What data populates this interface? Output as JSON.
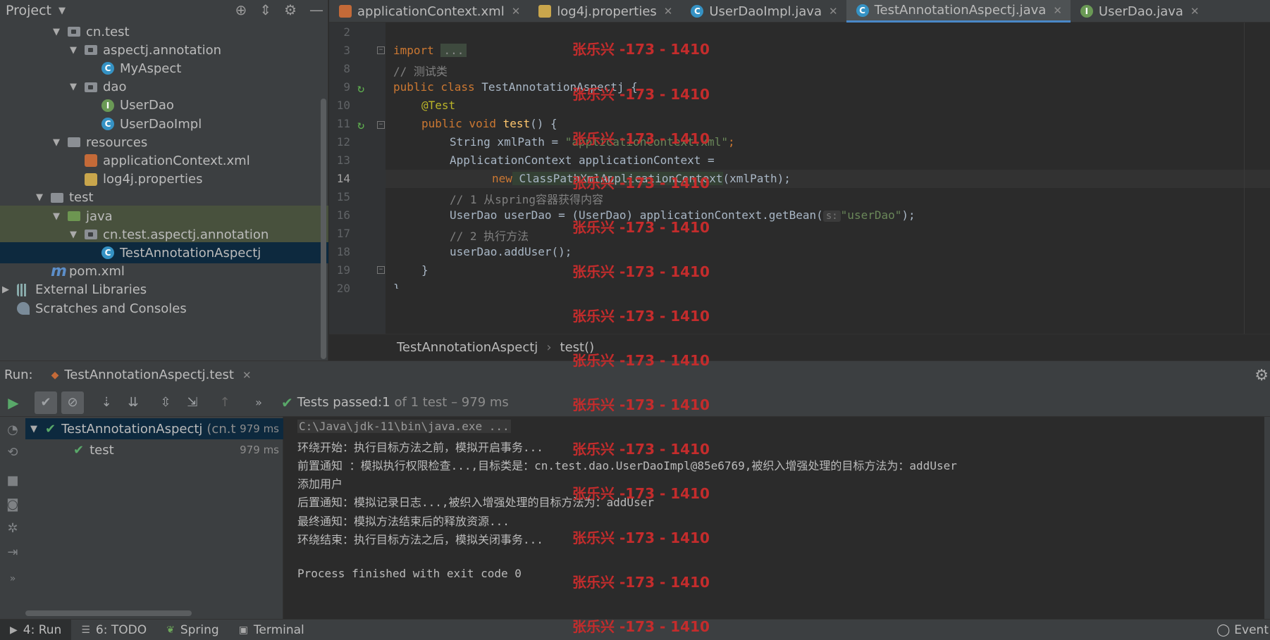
{
  "project": {
    "title": "Project",
    "tree": [
      {
        "label": "cn.test",
        "icon": "package-icon",
        "indent": 1,
        "arrow": "▼"
      },
      {
        "label": "aspectj.annotation",
        "icon": "package-icon",
        "indent": 2,
        "arrow": "▼"
      },
      {
        "label": "MyAspect",
        "icon": "class-icon",
        "indent": 3,
        "arrow": ""
      },
      {
        "label": "dao",
        "icon": "package-icon",
        "indent": 2,
        "arrow": "▼"
      },
      {
        "label": "UserDao",
        "icon": "interface-icon",
        "indent": 3,
        "arrow": ""
      },
      {
        "label": "UserDaoImpl",
        "icon": "class-icon",
        "indent": 3,
        "arrow": ""
      },
      {
        "label": "resources",
        "icon": "folder-icon",
        "indent": 1,
        "arrow": "▼"
      },
      {
        "label": "applicationContext.xml",
        "icon": "xml-file-icon",
        "indent": 2,
        "arrow": ""
      },
      {
        "label": "log4j.properties",
        "icon": "properties-file-icon",
        "indent": 2,
        "arrow": ""
      },
      {
        "label": "test",
        "icon": "folder-icon",
        "indent": 0,
        "arrow": "▼"
      },
      {
        "label": "java",
        "icon": "folder-icon",
        "indent": 1,
        "arrow": "▼"
      },
      {
        "label": "cn.test.aspectj.annotation",
        "icon": "package-icon",
        "indent": 2,
        "arrow": "▼"
      },
      {
        "label": "TestAnnotationAspectj",
        "icon": "class-icon",
        "indent": 3,
        "arrow": ""
      },
      {
        "label": "pom.xml",
        "icon": "maven-icon",
        "indent": 0,
        "arrow": ""
      },
      {
        "label": "External Libraries",
        "icon": "library-icon",
        "indent": -1,
        "arrow": "▶"
      },
      {
        "label": "Scratches and Consoles",
        "icon": "scratch-icon",
        "indent": -1,
        "arrow": ""
      }
    ]
  },
  "tabs": [
    {
      "label": "applicationContext.xml",
      "icon": "xml-file-icon",
      "active": false
    },
    {
      "label": "log4j.properties",
      "icon": "properties-file-icon",
      "active": false
    },
    {
      "label": "UserDaoImpl.java",
      "icon": "class-icon",
      "active": false
    },
    {
      "label": "TestAnnotationAspectj.java",
      "icon": "class-icon",
      "active": true
    },
    {
      "label": "UserDao.java",
      "icon": "interface-icon",
      "active": false
    }
  ],
  "editor": {
    "lines": [
      {
        "n": "2"
      },
      {
        "n": "3"
      },
      {
        "n": "8"
      },
      {
        "n": "9"
      },
      {
        "n": "10"
      },
      {
        "n": "11"
      },
      {
        "n": "12"
      },
      {
        "n": "13"
      },
      {
        "n": "14"
      },
      {
        "n": "15"
      },
      {
        "n": "16"
      },
      {
        "n": "17"
      },
      {
        "n": "18"
      },
      {
        "n": "19"
      },
      {
        "n": "20"
      }
    ],
    "code": {
      "import_kw": "import",
      "import_dots": "...",
      "comment_test_class": "// 测试类",
      "class_decl_kw": "public class",
      "class_name": " TestAnnotationAspectj {",
      "annotation": "@Test",
      "method_kw": "public void",
      "method_name": "test",
      "method_rest": "() {",
      "xml_decl": "String xmlPath = ",
      "xml_value": "\"applicationContext.xml\"",
      "semi": ";",
      "ctx_decl": "ApplicationContext applicationContext =",
      "new_kw": "new",
      "new_class": " ClassPathXmlApplicationContext",
      "new_args": "(xmlPath);",
      "comment_1": "// 1 从spring容器获得内容",
      "getbean_start": "UserDao userDao = (UserDao) applicationContext.getBean(",
      "param_hint": "s:",
      "getbean_arg": "\"userDao\"",
      "getbean_end": ");",
      "comment_2": "// 2 执行方法",
      "call": "userDao.addUser();",
      "close1": "}",
      "close2": "}"
    }
  },
  "breadcrumb": {
    "class": "TestAnnotationAspectj",
    "method": "test()"
  },
  "run": {
    "label": "Run:",
    "tab": "TestAnnotationAspectj.test",
    "status_prefix": "Tests passed: ",
    "status_count": "1",
    "status_rest": "of 1 test – 979 ms",
    "tree": [
      {
        "label": "TestAnnotationAspectj",
        "pkg": "(cn.t",
        "time": "979 ms"
      },
      {
        "label": "test",
        "pkg": "",
        "time": "979 ms"
      }
    ],
    "console": [
      "C:\\Java\\jdk-11\\bin\\java.exe ...",
      "环绕开始：执行目标方法之前，模拟开启事务...",
      "前置通知 ：模拟执行权限检查...,目标类是：cn.test.dao.UserDaoImpl@85e6769,被织入增强处理的目标方法为：addUser",
      "添加用户",
      "后置通知：模拟记录日志...,被织入增强处理的目标方法为：addUser",
      "最终通知：模拟方法结束后的释放资源...",
      "环绕结束：执行目标方法之后，模拟关闭事务...",
      "",
      "Process finished with exit code 0"
    ]
  },
  "bottombar": {
    "run": "4: Run",
    "todo": "6: TODO",
    "spring": "Spring",
    "terminal": "Terminal",
    "events": "Event"
  },
  "watermark": "张乐兴 -173 - 1410"
}
